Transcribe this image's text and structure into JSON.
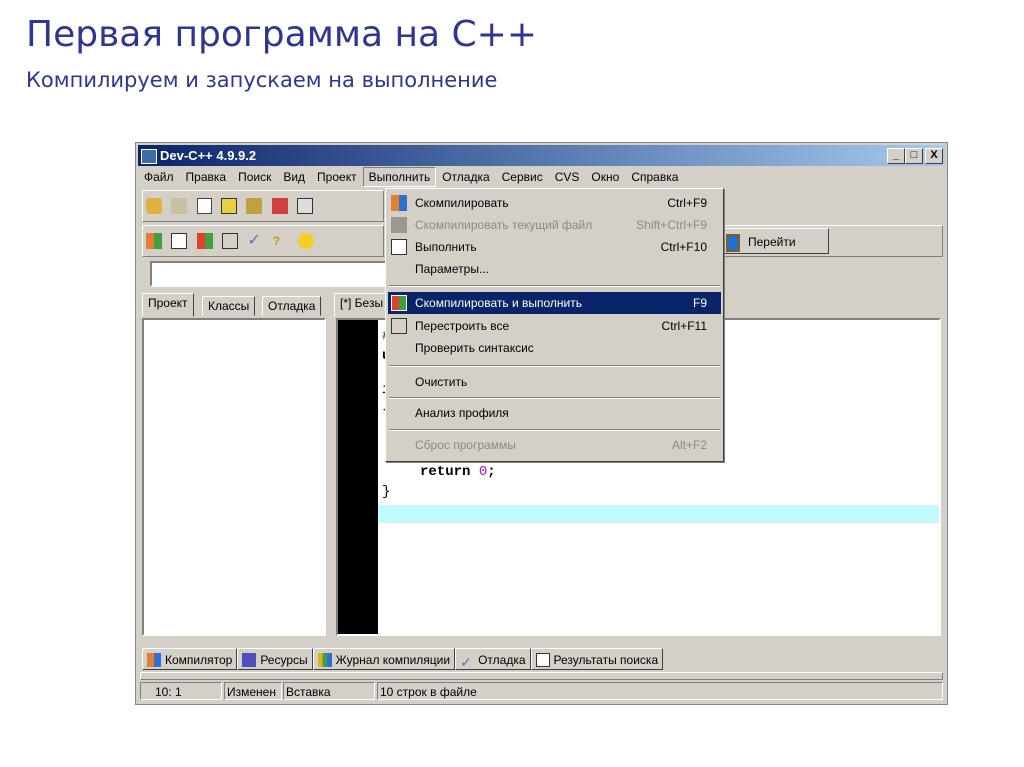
{
  "slide": {
    "title": "Первая программа на C++",
    "subtitle": "Компилируем и запускаем на выполнение"
  },
  "window": {
    "title": "Dev-C++ 4.9.9.2",
    "controls": {
      "minimize": "_",
      "maximize": "□",
      "close": "X"
    }
  },
  "menubar": [
    "Файл",
    "Правка",
    "Поиск",
    "Вид",
    "Проект",
    "Выполнить",
    "Отладка",
    "Сервис",
    "CVS",
    "Окно",
    "Справка"
  ],
  "toolbar": {
    "goto_label": "Перейти"
  },
  "left_tabs": [
    "Проект",
    "Классы",
    "Отладка"
  ],
  "editor": {
    "tab_label": "[*] Безы",
    "code_fragments": [
      "#",
      "u",
      "i",
      "{"
    ],
    "return_kw": "return",
    "return_val": "0",
    "semicolon": ";",
    "close_brace": "}"
  },
  "run_menu": [
    {
      "label": "Скомпилировать",
      "shortcut": "Ctrl+F9",
      "icon": "compile-icon",
      "disabled": false
    },
    {
      "label": "Скомпилировать текущий файл",
      "shortcut": "Shift+Ctrl+F9",
      "icon": "compile-file-icon",
      "disabled": true
    },
    {
      "label": "Выполнить",
      "shortcut": "Ctrl+F10",
      "icon": "run-icon",
      "disabled": false
    },
    {
      "label": "Параметры...",
      "shortcut": "",
      "disabled": false
    },
    {
      "label": "Скомпилировать и выполнить",
      "shortcut": "F9",
      "icon": "compile-run-icon",
      "disabled": false,
      "selected": true
    },
    {
      "label": "Перестроить все",
      "shortcut": "Ctrl+F11",
      "icon": "rebuild-icon",
      "disabled": false
    },
    {
      "label": "Проверить синтаксис",
      "shortcut": "",
      "disabled": false
    },
    {
      "label": "Очистить",
      "shortcut": "",
      "disabled": false
    },
    {
      "label": "Анализ профиля",
      "shortcut": "",
      "disabled": false
    },
    {
      "label": "Сброс программы",
      "shortcut": "Alt+F2",
      "disabled": true
    }
  ],
  "bottom_tabs": [
    "Компилятор",
    "Ресурсы",
    "Журнал компиляции",
    "Отладка",
    "Результаты поиска"
  ],
  "statusbar": {
    "position": "10: 1",
    "modified": "Изменен",
    "mode": "Вставка",
    "lines": "10 строк в файле"
  }
}
